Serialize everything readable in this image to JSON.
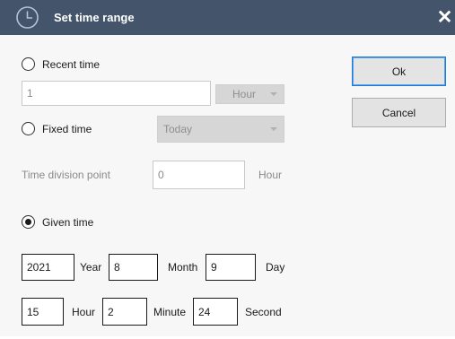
{
  "window": {
    "title": "Set time range",
    "close_glyph": "✕",
    "icon": "clock-icon",
    "titlebar_color": "#44546a"
  },
  "recent_time": {
    "label": "Recent time",
    "checked": false,
    "value": "1",
    "unit_selected": "Hour"
  },
  "fixed_time": {
    "label": "Fixed time",
    "checked": false,
    "selected": "Today"
  },
  "time_division": {
    "label": "Time division point",
    "value": "0",
    "unit": "Hour"
  },
  "given_time": {
    "label": "Given time",
    "checked": true,
    "year": {
      "value": "2021",
      "label": "Year"
    },
    "month": {
      "value": "8",
      "label": "Month"
    },
    "day": {
      "value": "9",
      "label": "Day"
    },
    "hour": {
      "value": "15",
      "label": "Hour"
    },
    "minute": {
      "value": "2",
      "label": "Minute"
    },
    "second": {
      "value": "24",
      "label": "Second"
    }
  },
  "buttons": {
    "ok": "Ok",
    "cancel": "Cancel",
    "ok_accent": "#1e7ad6"
  }
}
